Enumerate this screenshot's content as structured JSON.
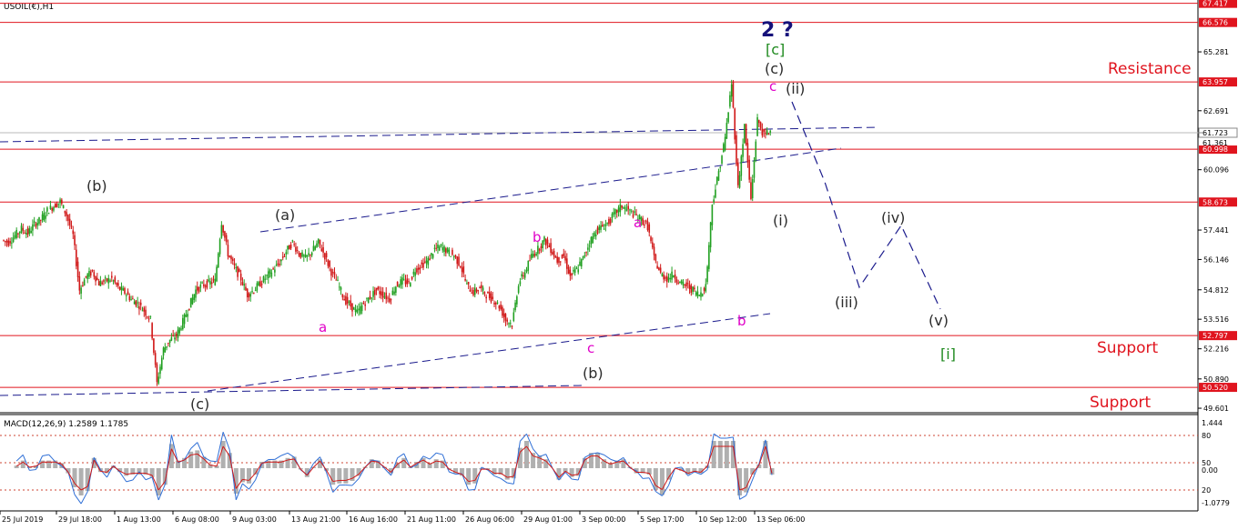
{
  "symbol_label": "USOIL(€),H1",
  "macd_label": "MACD(12,26,9) 1.2589 1.1785",
  "chart_data": {
    "type": "candlestick",
    "title": "",
    "symbol": "USOIL",
    "timeframe": "H1",
    "price_axis_ticks": [
      65.281,
      62.691,
      60.096,
      57.441,
      56.146,
      54.812,
      53.516,
      52.216,
      50.89,
      49.601
    ],
    "current_price": 61.723,
    "secondary_price_tag": 61.361,
    "macd_axis_ticks": [
      "1.444",
      "80",
      "50",
      "0.00",
      "20",
      "-1.0779"
    ],
    "time_labels": [
      "25 Jul 2019",
      "29 Jul 18:00",
      "1 Aug 13:00",
      "6 Aug 08:00",
      "9 Aug 03:00",
      "13 Aug 21:00",
      "16 Aug 16:00",
      "21 Aug 11:00",
      "26 Aug 06:00",
      "29 Aug 01:00",
      "3 Sep 00:00",
      "5 Sep 17:00",
      "10 Sep 12:00",
      "13 Sep 06:00"
    ],
    "horizontal_levels": [
      {
        "price": 67.417,
        "label": "67.417"
      },
      {
        "price": 66.576,
        "label": "66.576"
      },
      {
        "price": 63.957,
        "label": "63.957"
      },
      {
        "price": 60.998,
        "label": "60.998"
      },
      {
        "price": 58.673,
        "label": "58.673"
      },
      {
        "price": 52.797,
        "label": "52.797"
      },
      {
        "price": 50.52,
        "label": "50.520"
      }
    ],
    "zones": [
      "Resistance",
      "Support",
      "Support"
    ],
    "wave_labels": {
      "title": "2 ?",
      "green": [
        "[c]",
        "[i]"
      ],
      "dark": [
        "(c)",
        "(ii)",
        "(b)",
        "(a)",
        "(i)",
        "(iv)",
        "(iii)",
        "(v)",
        "(b)",
        "(c)"
      ],
      "pink": [
        "c",
        "a",
        "b",
        "a",
        "c",
        "b"
      ]
    },
    "price_series": [
      57.0,
      56.9,
      57.2,
      57.5,
      57.3,
      57.7,
      57.9,
      58.3,
      58.5,
      58.7,
      58.1,
      57.2,
      54.8,
      55.4,
      55.6,
      55.1,
      55.2,
      55.3,
      54.9,
      54.7,
      54.4,
      54.2,
      53.9,
      53.5,
      50.7,
      52.2,
      52.6,
      52.8,
      53.4,
      54.1,
      54.8,
      55.0,
      55.1,
      55.2,
      57.8,
      56.4,
      55.8,
      55.3,
      54.6,
      54.8,
      55.1,
      55.4,
      55.7,
      56.0,
      56.5,
      56.9,
      56.4,
      56.2,
      56.5,
      56.9,
      56.3,
      55.6,
      55.1,
      54.4,
      54.1,
      53.8,
      54.2,
      54.5,
      54.8,
      54.6,
      54.4,
      55.0,
      55.2,
      55.1,
      55.7,
      55.9,
      56.1,
      56.6,
      56.7,
      56.5,
      56.3,
      55.9,
      55.0,
      54.7,
      54.9,
      54.6,
      54.4,
      54.1,
      53.5,
      53.3,
      55.1,
      55.6,
      56.3,
      56.6,
      57.0,
      56.6,
      56.1,
      56.3,
      55.4,
      55.7,
      56.2,
      56.9,
      57.4,
      57.6,
      57.8,
      58.2,
      58.5,
      58.3,
      58.1,
      57.9,
      57.6,
      56.2,
      55.5,
      55.3,
      55.5,
      55.1,
      55.0,
      54.8,
      54.6,
      55.0,
      58.6,
      60.0,
      61.5,
      63.9,
      59.3,
      62.0,
      58.8,
      62.3,
      61.6,
      61.8
    ]
  }
}
